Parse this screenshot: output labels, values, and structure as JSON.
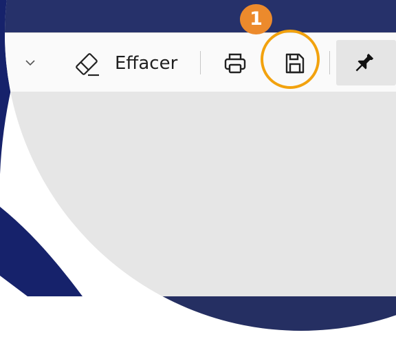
{
  "toolbar": {
    "eraser_label": "Effacer",
    "icons": [
      "chevron-down-icon",
      "eraser-icon",
      "print-icon",
      "save-icon",
      "pin-icon"
    ]
  },
  "annotation": {
    "step_number": "1",
    "badge_color": "#ec8a2c",
    "highlight_color": "#f2a20e"
  },
  "colors": {
    "frame_navy": "#16226b",
    "window_dark": "#26316a",
    "content_gray": "#e6e6e6"
  }
}
